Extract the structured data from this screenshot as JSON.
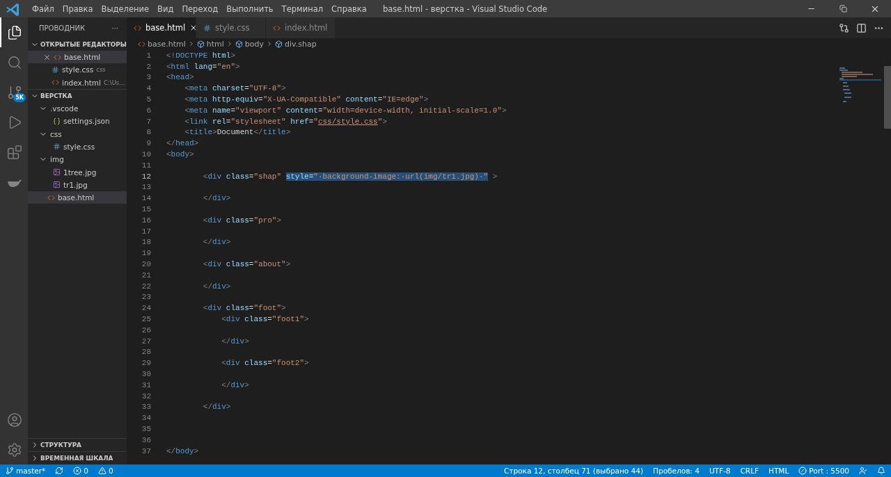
{
  "window": {
    "title": "base.html - верстка - Visual Studio Code"
  },
  "menu": [
    "Файл",
    "Правка",
    "Выделение",
    "Вид",
    "Переход",
    "Выполнить",
    "Терминал",
    "Справка"
  ],
  "activity_bar": {
    "items": [
      {
        "kind": "explorer",
        "selected": true
      },
      {
        "kind": "search",
        "selected": false
      },
      {
        "kind": "source-control",
        "selected": false,
        "badge": "5K"
      },
      {
        "kind": "run",
        "selected": false
      },
      {
        "kind": "extensions",
        "selected": false
      },
      {
        "kind": "docker",
        "selected": false
      }
    ],
    "bottom": [
      {
        "kind": "account"
      },
      {
        "kind": "settings"
      }
    ]
  },
  "sidebar": {
    "title": "ПРОВОДНИК",
    "more": "···",
    "open_editors": {
      "title": "ОТКРЫТЫЕ РЕДАКТОРЫ",
      "expanded": true,
      "items": [
        {
          "name": "base.html",
          "kind": "html",
          "selected": true
        },
        {
          "name": "style.css",
          "kind": "css",
          "selected": false,
          "description": "css"
        },
        {
          "name": "index.html",
          "kind": "html",
          "selected": false,
          "description": "C:\\Us..."
        }
      ]
    },
    "folder": {
      "title": "ВЕРСТКА",
      "expanded": true,
      "items": [
        {
          "name": ".vscode",
          "kind": "folder",
          "expanded": true,
          "selected": false,
          "children": [
            {
              "name": "settings.json",
              "kind": "json",
              "selected": false
            }
          ]
        },
        {
          "name": "css",
          "kind": "folder",
          "expanded": true,
          "selected": false,
          "children": [
            {
              "name": "style.css",
              "kind": "css",
              "selected": false
            }
          ]
        },
        {
          "name": "img",
          "kind": "folder",
          "expanded": true,
          "selected": false,
          "children": [
            {
              "name": "1tree.jpg",
              "kind": "image",
              "selected": false
            },
            {
              "name": "tr1.jpg",
              "kind": "image",
              "selected": false
            }
          ]
        },
        {
          "name": "base.html",
          "kind": "html",
          "selected": true
        }
      ]
    },
    "panels": [
      {
        "title": "СТРУКТУРА",
        "expanded": false
      },
      {
        "title": "ВРЕМЕННАЯ ШКАЛА",
        "expanded": false
      }
    ]
  },
  "tabs": [
    {
      "label": "base.html",
      "kind": "html",
      "selected": true
    },
    {
      "label": "style.css",
      "kind": "css",
      "selected": false
    },
    {
      "label": "index.html",
      "kind": "html",
      "selected": false
    }
  ],
  "breadcrumbs": [
    {
      "label": "base.html",
      "kind": "html"
    },
    {
      "label": "html",
      "kind": "element"
    },
    {
      "label": "body",
      "kind": "element"
    },
    {
      "label": "div.shap",
      "kind": "element"
    }
  ],
  "editor": {
    "lines": [
      {
        "number": "1",
        "selected": false,
        "tokens": [
          {
            "kind": "p",
            "text": "<!"
          },
          {
            "kind": "t",
            "text": "DOCTYPE"
          },
          {
            "kind": "a",
            "text": " html"
          },
          {
            "kind": "p",
            "text": ">"
          }
        ]
      },
      {
        "number": "2",
        "selected": false,
        "tokens": [
          {
            "kind": "p",
            "text": "<"
          },
          {
            "kind": "t",
            "text": "html"
          },
          {
            "kind": "a",
            "text": " lang"
          },
          {
            "kind": "x",
            "text": "="
          },
          {
            "kind": "s",
            "text": "\"en\""
          },
          {
            "kind": "p",
            "text": ">"
          }
        ]
      },
      {
        "number": "3",
        "selected": false,
        "tokens": [
          {
            "kind": "p",
            "text": "<"
          },
          {
            "kind": "t",
            "text": "head"
          },
          {
            "kind": "p",
            "text": ">"
          }
        ]
      },
      {
        "number": "4",
        "selected": false,
        "tokens": [
          {
            "kind": "p",
            "text": "    <"
          },
          {
            "kind": "t",
            "text": "meta"
          },
          {
            "kind": "a",
            "text": " charset"
          },
          {
            "kind": "x",
            "text": "="
          },
          {
            "kind": "s",
            "text": "\"UTF-8\""
          },
          {
            "kind": "p",
            "text": ">"
          }
        ]
      },
      {
        "number": "5",
        "selected": false,
        "tokens": [
          {
            "kind": "p",
            "text": "    <"
          },
          {
            "kind": "t",
            "text": "meta"
          },
          {
            "kind": "a",
            "text": " http-equiv"
          },
          {
            "kind": "x",
            "text": "="
          },
          {
            "kind": "s",
            "text": "\"X-UA-Compatible\""
          },
          {
            "kind": "a",
            "text": " content"
          },
          {
            "kind": "x",
            "text": "="
          },
          {
            "kind": "s",
            "text": "\"IE=edge\""
          },
          {
            "kind": "p",
            "text": ">"
          }
        ]
      },
      {
        "number": "6",
        "selected": false,
        "tokens": [
          {
            "kind": "p",
            "text": "    <"
          },
          {
            "kind": "t",
            "text": "meta"
          },
          {
            "kind": "a",
            "text": " name"
          },
          {
            "kind": "x",
            "text": "="
          },
          {
            "kind": "s",
            "text": "\"viewport\""
          },
          {
            "kind": "a",
            "text": " content"
          },
          {
            "kind": "x",
            "text": "="
          },
          {
            "kind": "s",
            "text": "\"width=device-width, initial-scale=1.0\""
          },
          {
            "kind": "p",
            "text": ">"
          }
        ]
      },
      {
        "number": "7",
        "selected": false,
        "tokens": [
          {
            "kind": "p",
            "text": "    <"
          },
          {
            "kind": "t",
            "text": "link"
          },
          {
            "kind": "a",
            "text": " rel"
          },
          {
            "kind": "x",
            "text": "="
          },
          {
            "kind": "s",
            "text": "\"stylesheet\""
          },
          {
            "kind": "a",
            "text": " href"
          },
          {
            "kind": "x",
            "text": "="
          },
          {
            "kind": "s",
            "text": "\""
          },
          {
            "kind": "l",
            "text": "css/style.css"
          },
          {
            "kind": "s",
            "text": "\""
          },
          {
            "kind": "p",
            "text": ">"
          }
        ]
      },
      {
        "number": "8",
        "selected": false,
        "tokens": [
          {
            "kind": "p",
            "text": "    <"
          },
          {
            "kind": "t",
            "text": "title"
          },
          {
            "kind": "p",
            "text": ">"
          },
          {
            "kind": "x",
            "text": "Document"
          },
          {
            "kind": "p",
            "text": "</"
          },
          {
            "kind": "t",
            "text": "title"
          },
          {
            "kind": "p",
            "text": ">"
          }
        ]
      },
      {
        "number": "9",
        "selected": false,
        "tokens": [
          {
            "kind": "p",
            "text": "</"
          },
          {
            "kind": "t",
            "text": "head"
          },
          {
            "kind": "p",
            "text": ">"
          }
        ]
      },
      {
        "number": "10",
        "selected": false,
        "tokens": [
          {
            "kind": "p",
            "text": "<"
          },
          {
            "kind": "t",
            "text": "body"
          },
          {
            "kind": "p",
            "text": ">"
          }
        ]
      },
      {
        "number": "11",
        "selected": false
      },
      {
        "number": "12",
        "selected": true,
        "tokens": [
          {
            "kind": "p",
            "text": "        <",
            "highlighted": false
          },
          {
            "kind": "t",
            "text": "div",
            "highlighted": false
          },
          {
            "kind": "a",
            "text": " class",
            "highlighted": false
          },
          {
            "kind": "x",
            "text": "=",
            "highlighted": false
          },
          {
            "kind": "s",
            "text": "\"shap\" ",
            "highlighted": false
          },
          {
            "kind": "a",
            "text": "style",
            "highlighted": true
          },
          {
            "kind": "x",
            "text": "=",
            "highlighted": true
          },
          {
            "kind": "s",
            "text": "\"·background-image:·url(img/tr1.jpg)·\"",
            "highlighted": true
          },
          {
            "kind": "p",
            "text": " >",
            "highlighted": false
          }
        ]
      },
      {
        "number": "13",
        "selected": false
      },
      {
        "number": "14",
        "selected": false,
        "tokens": [
          {
            "kind": "p",
            "text": "        </"
          },
          {
            "kind": "t",
            "text": "div"
          },
          {
            "kind": "p",
            "text": ">"
          }
        ]
      },
      {
        "number": "15",
        "selected": false
      },
      {
        "number": "16",
        "selected": false,
        "tokens": [
          {
            "kind": "p",
            "text": "        <"
          },
          {
            "kind": "t",
            "text": "div"
          },
          {
            "kind": "a",
            "text": " class"
          },
          {
            "kind": "x",
            "text": "="
          },
          {
            "kind": "s",
            "text": "\"pro\""
          },
          {
            "kind": "p",
            "text": ">"
          }
        ]
      },
      {
        "number": "17",
        "selected": false
      },
      {
        "number": "18",
        "selected": false,
        "tokens": [
          {
            "kind": "p",
            "text": "        </"
          },
          {
            "kind": "t",
            "text": "div"
          },
          {
            "kind": "p",
            "text": ">"
          }
        ]
      },
      {
        "number": "19",
        "selected": false
      },
      {
        "number": "20",
        "selected": false,
        "tokens": [
          {
            "kind": "p",
            "text": "        <"
          },
          {
            "kind": "t",
            "text": "div"
          },
          {
            "kind": "a",
            "text": " class"
          },
          {
            "kind": "x",
            "text": "="
          },
          {
            "kind": "s",
            "text": "\"about\""
          },
          {
            "kind": "p",
            "text": ">"
          }
        ]
      },
      {
        "number": "21",
        "selected": false
      },
      {
        "number": "22",
        "selected": false,
        "tokens": [
          {
            "kind": "p",
            "text": "        </"
          },
          {
            "kind": "t",
            "text": "div"
          },
          {
            "kind": "p",
            "text": ">"
          }
        ]
      },
      {
        "number": "23",
        "selected": false
      },
      {
        "number": "24",
        "selected": false,
        "tokens": [
          {
            "kind": "p",
            "text": "        <"
          },
          {
            "kind": "t",
            "text": "div"
          },
          {
            "kind": "a",
            "text": " class"
          },
          {
            "kind": "x",
            "text": "="
          },
          {
            "kind": "s",
            "text": "\"foot\""
          },
          {
            "kind": "p",
            "text": ">"
          }
        ]
      },
      {
        "number": "25",
        "selected": false,
        "tokens": [
          {
            "kind": "p",
            "text": "            <"
          },
          {
            "kind": "t",
            "text": "div"
          },
          {
            "kind": "a",
            "text": " class"
          },
          {
            "kind": "x",
            "text": "="
          },
          {
            "kind": "s",
            "text": "\"foot1\""
          },
          {
            "kind": "p",
            "text": ">"
          }
        ]
      },
      {
        "number": "26",
        "selected": false
      },
      {
        "number": "27",
        "selected": false,
        "tokens": [
          {
            "kind": "p",
            "text": "            </"
          },
          {
            "kind": "t",
            "text": "div"
          },
          {
            "kind": "p",
            "text": ">"
          }
        ]
      },
      {
        "number": "28",
        "selected": false
      },
      {
        "number": "29",
        "selected": false,
        "tokens": [
          {
            "kind": "p",
            "text": "            <"
          },
          {
            "kind": "t",
            "text": "div"
          },
          {
            "kind": "a",
            "text": " class"
          },
          {
            "kind": "x",
            "text": "="
          },
          {
            "kind": "s",
            "text": "\"foot2\""
          },
          {
            "kind": "p",
            "text": ">"
          }
        ]
      },
      {
        "number": "30",
        "selected": false
      },
      {
        "number": "31",
        "selected": false,
        "tokens": [
          {
            "kind": "p",
            "text": "            </"
          },
          {
            "kind": "t",
            "text": "div"
          },
          {
            "kind": "p",
            "text": ">"
          }
        ]
      },
      {
        "number": "32",
        "selected": false
      },
      {
        "number": "33",
        "selected": false,
        "tokens": [
          {
            "kind": "p",
            "text": "        </"
          },
          {
            "kind": "t",
            "text": "div"
          },
          {
            "kind": "p",
            "text": ">"
          }
        ]
      },
      {
        "number": "34",
        "selected": false
      },
      {
        "number": "35",
        "selected": false
      },
      {
        "number": "36",
        "selected": false
      },
      {
        "number": "37",
        "selected": false,
        "tokens": [
          {
            "kind": "p",
            "text": "</"
          },
          {
            "kind": "t",
            "text": "body"
          },
          {
            "kind": "p",
            "text": ">"
          }
        ]
      }
    ]
  },
  "status_bar": {
    "left": [
      {
        "kind": "branch",
        "text": "master*"
      },
      {
        "kind": "sync"
      },
      {
        "kind": "errors",
        "text": "0"
      },
      {
        "kind": "warnings",
        "text": "0"
      }
    ],
    "right": [
      {
        "kind": "text",
        "text": "Строка 12, столбец 71 (выбрано 44)"
      },
      {
        "kind": "text",
        "text": "Пробелов: 4"
      },
      {
        "kind": "text",
        "text": "UTF-8"
      },
      {
        "kind": "text",
        "text": "CRLF"
      },
      {
        "kind": "text",
        "text": "HTML"
      },
      {
        "kind": "port",
        "text": "Port : 5500"
      },
      {
        "kind": "feedback"
      },
      {
        "kind": "notifications"
      }
    ]
  }
}
